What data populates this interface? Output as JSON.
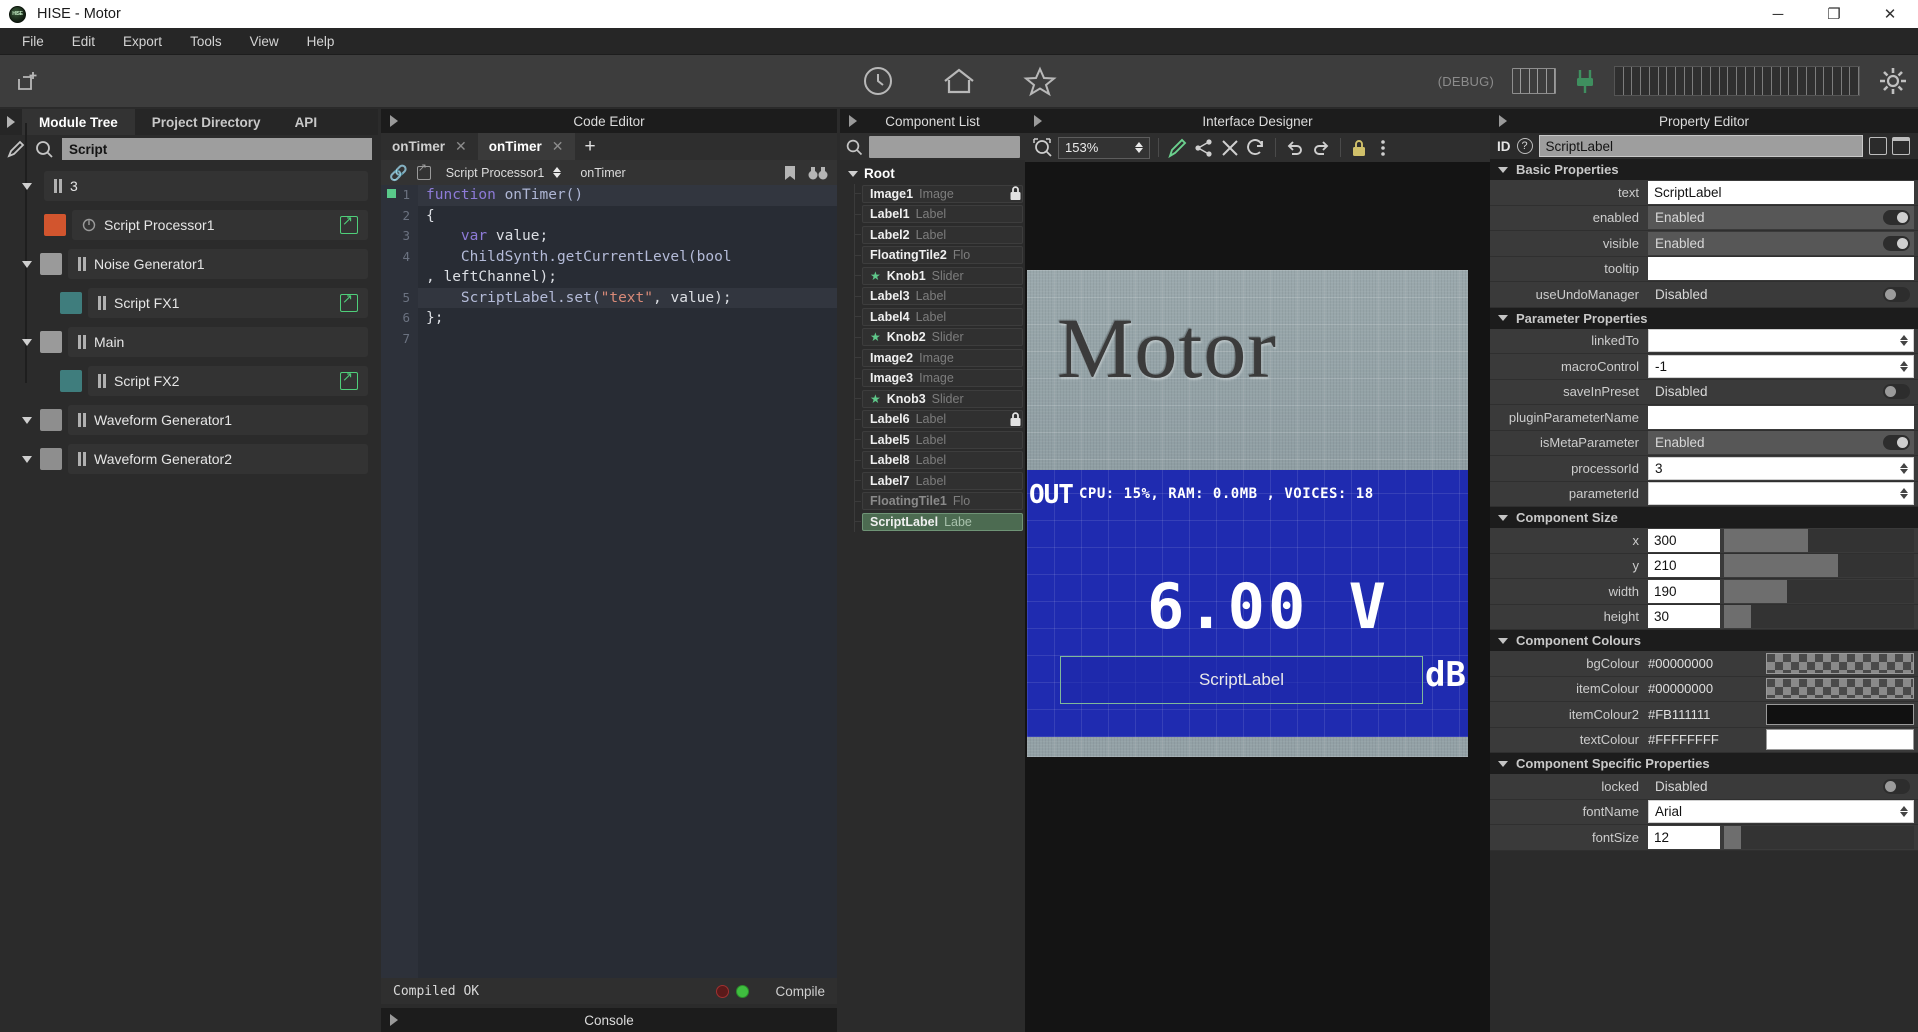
{
  "window": {
    "title": "HISE - Motor",
    "logo_text": "HISE",
    "minimize": "─",
    "maximize": "❐",
    "close": "✕"
  },
  "menubar": {
    "items": [
      "File",
      "Edit",
      "Export",
      "Tools",
      "View",
      "Help"
    ]
  },
  "main_toolbar": {
    "new_project_icon": "new-document-icon",
    "preset_icon": "clock-icon",
    "home_icon": "home-icon",
    "favourite_icon": "star-icon",
    "debug_label": "(DEBUG)",
    "keyboard_icon": "keyboard-icon",
    "plug_icon": "plug-icon",
    "midi_icon": "midi-keyboard-icon",
    "settings_icon": "gear-icon"
  },
  "left_panel": {
    "tabs": [
      {
        "label": "Module Tree",
        "active": true
      },
      {
        "label": "Project Directory",
        "active": false
      },
      {
        "label": "API",
        "active": false
      }
    ],
    "search_value": "Script",
    "tree": [
      {
        "label": "3",
        "indent": 0,
        "swatch": "none",
        "expander": true,
        "bars": true,
        "ext": false
      },
      {
        "label": "Script Processor1",
        "indent": 1,
        "swatch": "#d2552e",
        "expander": false,
        "knob": true,
        "ext": true
      },
      {
        "label": "Noise Generator1",
        "indent": 0,
        "swatch": "#9a9a9a",
        "expander": true,
        "bars": true,
        "ext": false
      },
      {
        "label": "Script FX1",
        "indent": 1,
        "swatch": "#3f7d7d",
        "expander": false,
        "bars": true,
        "ext": true
      },
      {
        "label": "Main",
        "indent": 0,
        "swatch": "#9a9a9a",
        "expander": true,
        "bars": true,
        "ext": false
      },
      {
        "label": "Script FX2",
        "indent": 1,
        "swatch": "#3f7d7d",
        "expander": false,
        "bars": true,
        "ext": true
      },
      {
        "label": "Waveform Generator1",
        "indent": 0,
        "swatch": "#8e8e8e",
        "expander": true,
        "bars": true,
        "ext": false
      },
      {
        "label": "Waveform Generator2",
        "indent": 0,
        "swatch": "#8e8e8e",
        "expander": true,
        "bars": true,
        "ext": false
      }
    ]
  },
  "code_editor": {
    "panel_title": "Code Editor",
    "tabs": [
      {
        "label": "onTimer",
        "active": false
      },
      {
        "label": "onTimer",
        "active": true
      }
    ],
    "add_tab": "+",
    "close_glyph": "✕",
    "processor": "Script Processor1",
    "callback": "onTimer",
    "bookmark_icon": "bookmark-icon",
    "find_icon": "binoculars-icon",
    "lines": [
      {
        "n": "1",
        "tokens": [
          {
            "t": "function ",
            "c": "kw"
          },
          {
            "t": "onTimer()",
            "c": "fn"
          }
        ],
        "hl": true
      },
      {
        "n": "2",
        "tokens": [
          {
            "t": "{",
            "c": "p"
          }
        ],
        "hl": false
      },
      {
        "n": "3",
        "tokens": [
          {
            "t": "    ",
            "c": "p"
          },
          {
            "t": "var",
            "c": "kw"
          },
          {
            "t": " value;",
            "c": "p"
          }
        ],
        "hl": false
      },
      {
        "n": "4",
        "tokens": [
          {
            "t": "    ChildSynth.getCurrentLevel(bool",
            "c": "p"
          }
        ],
        "hl": false,
        "wrap": ", leftChannel);"
      },
      {
        "n": "5",
        "tokens": [
          {
            "t": "    ScriptLabel.set(",
            "c": "p"
          },
          {
            "t": "\"text\"",
            "c": "str"
          },
          {
            "t": ", value);",
            "c": "p"
          }
        ],
        "hl": true
      },
      {
        "n": "6",
        "tokens": [
          {
            "t": "};",
            "c": "p"
          }
        ],
        "hl": false
      },
      {
        "n": "7",
        "tokens": [
          {
            "t": "",
            "c": "p"
          }
        ],
        "hl": false
      }
    ],
    "status_text": "Compiled OK",
    "compile_label": "Compile",
    "console_title": "Console"
  },
  "component_list": {
    "panel_title": "Component List",
    "search_placeholder": "",
    "root_label": "Root",
    "items": [
      {
        "name": "Image1",
        "type": "Image",
        "star": false,
        "locked": true,
        "selected": false,
        "dim": false
      },
      {
        "name": "Label1",
        "type": "Label",
        "star": false,
        "locked": false,
        "selected": false,
        "dim": false
      },
      {
        "name": "Label2",
        "type": "Label",
        "star": false,
        "locked": false,
        "selected": false,
        "dim": false
      },
      {
        "name": "FloatingTile2",
        "type": "Flo",
        "star": false,
        "locked": false,
        "selected": false,
        "dim": false
      },
      {
        "name": "Knob1",
        "type": "Slider",
        "star": true,
        "locked": false,
        "selected": false,
        "dim": false
      },
      {
        "name": "Label3",
        "type": "Label",
        "star": false,
        "locked": false,
        "selected": false,
        "dim": false
      },
      {
        "name": "Label4",
        "type": "Label",
        "star": false,
        "locked": false,
        "selected": false,
        "dim": false
      },
      {
        "name": "Knob2",
        "type": "Slider",
        "star": true,
        "locked": false,
        "selected": false,
        "dim": false
      },
      {
        "name": "Image2",
        "type": "Image",
        "star": false,
        "locked": false,
        "selected": false,
        "dim": false
      },
      {
        "name": "Image3",
        "type": "Image",
        "star": false,
        "locked": false,
        "selected": false,
        "dim": false
      },
      {
        "name": "Knob3",
        "type": "Slider",
        "star": true,
        "locked": false,
        "selected": false,
        "dim": false
      },
      {
        "name": "Label6",
        "type": "Label",
        "star": false,
        "locked": true,
        "selected": false,
        "dim": false
      },
      {
        "name": "Label5",
        "type": "Label",
        "star": false,
        "locked": false,
        "selected": false,
        "dim": false
      },
      {
        "name": "Label8",
        "type": "Label",
        "star": false,
        "locked": false,
        "selected": false,
        "dim": false
      },
      {
        "name": "Label7",
        "type": "Label",
        "star": false,
        "locked": false,
        "selected": false,
        "dim": false
      },
      {
        "name": "FloatingTile1",
        "type": "Flo",
        "star": false,
        "locked": false,
        "selected": false,
        "dim": true
      },
      {
        "name": "ScriptLabel",
        "type": "Labe",
        "star": false,
        "locked": false,
        "selected": true,
        "dim": false
      }
    ]
  },
  "interface_designer": {
    "panel_title": "Interface Designer",
    "zoom": "153%",
    "tools": [
      {
        "name": "fit-to-screen-icon"
      },
      {
        "name": "edit-pen-icon"
      },
      {
        "name": "share-icon"
      },
      {
        "name": "delete-icon"
      },
      {
        "name": "refresh-icon"
      },
      {
        "name": "undo-icon"
      },
      {
        "name": "redo-icon"
      },
      {
        "name": "lock-icon"
      },
      {
        "name": "more-icon"
      }
    ],
    "plugin_canvas": {
      "brand": "Motor",
      "lcd_out": "OUT",
      "lcd_stats": "CPU: 15%, RAM: 0.0MB , VOICES: 18",
      "lcd_value": "6.00 V",
      "lcd_db": "dB",
      "script_label_text": "ScriptLabel"
    }
  },
  "property_editor": {
    "panel_title": "Property Editor",
    "id_label": "ID",
    "id_value": "ScriptLabel",
    "help_icon": "question-mark-icon",
    "copy_icon": "copy-properties-icon",
    "paste_icon": "paste-properties-icon",
    "sections": [
      {
        "title": "Basic Properties",
        "rows": [
          {
            "name": "text",
            "kind": "text",
            "value": "ScriptLabel"
          },
          {
            "name": "enabled",
            "kind": "toggle",
            "value": "Enabled",
            "on": true
          },
          {
            "name": "visible",
            "kind": "toggle",
            "value": "Enabled",
            "on": true
          },
          {
            "name": "tooltip",
            "kind": "text",
            "value": ""
          },
          {
            "name": "useUndoManager",
            "kind": "toggle",
            "value": "Disabled",
            "on": false
          }
        ]
      },
      {
        "title": "Parameter Properties",
        "rows": [
          {
            "name": "linkedTo",
            "kind": "combo",
            "value": ""
          },
          {
            "name": "macroControl",
            "kind": "combo",
            "value": "-1"
          },
          {
            "name": "saveInPreset",
            "kind": "toggle",
            "value": "Disabled",
            "on": false
          },
          {
            "name": "pluginParameterName",
            "kind": "text",
            "value": ""
          },
          {
            "name": "isMetaParameter",
            "kind": "toggle",
            "value": "Enabled",
            "on": true
          },
          {
            "name": "processorId",
            "kind": "combo",
            "value": "3"
          },
          {
            "name": "parameterId",
            "kind": "combo",
            "value": ""
          }
        ]
      },
      {
        "title": "Component Size",
        "rows": [
          {
            "name": "x",
            "kind": "slider",
            "value": "300",
            "pct": 44
          },
          {
            "name": "y",
            "kind": "slider",
            "value": "210",
            "pct": 60
          },
          {
            "name": "width",
            "kind": "slider",
            "value": "190",
            "pct": 33
          },
          {
            "name": "height",
            "kind": "slider",
            "value": "30",
            "pct": 14
          }
        ]
      },
      {
        "title": "Component Colours",
        "rows": [
          {
            "name": "bgColour",
            "kind": "colour",
            "value": "#00000000",
            "swatch": "transparent"
          },
          {
            "name": "itemColour",
            "kind": "colour",
            "value": "#00000000",
            "swatch": "transparent"
          },
          {
            "name": "itemColour2",
            "kind": "colour",
            "value": "#FB111111",
            "swatch": "#111111"
          },
          {
            "name": "textColour",
            "kind": "colour",
            "value": "#FFFFFFFF",
            "swatch": "#FFFFFF"
          }
        ]
      },
      {
        "title": "Component Specific Properties",
        "rows": [
          {
            "name": "locked",
            "kind": "toggle",
            "value": "Disabled",
            "on": false
          },
          {
            "name": "fontName",
            "kind": "combo",
            "value": "Arial"
          },
          {
            "name": "fontSize",
            "kind": "slider",
            "value": "12",
            "pct": 9
          }
        ]
      }
    ]
  }
}
